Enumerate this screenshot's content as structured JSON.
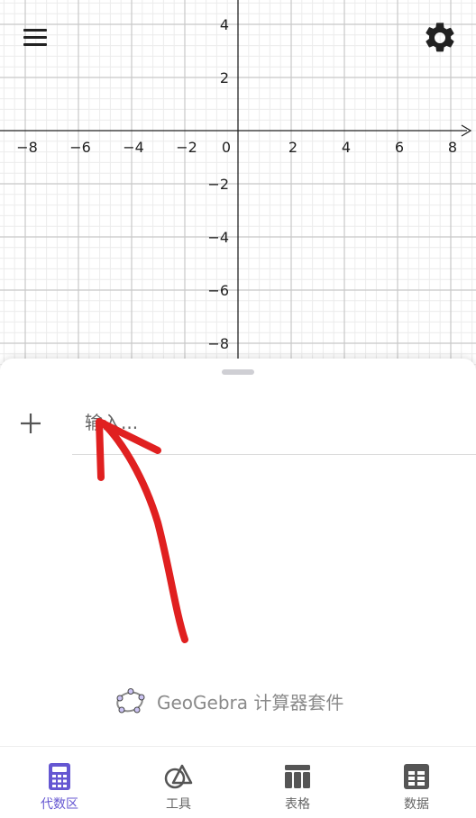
{
  "graph": {
    "x_range": [
      -9,
      9
    ],
    "y_range": [
      -9,
      5
    ],
    "x_ticks": [
      -8,
      -6,
      -4,
      -2,
      2,
      4,
      6,
      8
    ],
    "y_ticks": [
      4,
      2,
      -2,
      -4,
      -6,
      -8
    ],
    "origin_label": "0",
    "x_tick_labels": [
      "−8",
      "−6",
      "−4",
      "−2",
      "2",
      "4",
      "6",
      "8"
    ],
    "y_tick_labels": [
      "4",
      "2",
      "−2",
      "−4",
      "−6",
      "−8"
    ]
  },
  "header": {
    "menu_icon": "hamburger-menu-icon",
    "settings_icon": "gear-icon"
  },
  "algebra": {
    "add_icon": "plus-icon",
    "input_placeholder": "输入..."
  },
  "brand": {
    "name": "GeoGebra 计算器套件",
    "logo_icon": "geogebra-logo-icon"
  },
  "nav": {
    "items": [
      {
        "label": "代数区",
        "icon": "calculator-icon",
        "active": true
      },
      {
        "label": "工具",
        "icon": "shapes-icon",
        "active": false
      },
      {
        "label": "表格",
        "icon": "table-icon",
        "active": false
      },
      {
        "label": "数据",
        "icon": "spreadsheet-icon",
        "active": false
      }
    ]
  },
  "colors": {
    "accent": "#6557d2",
    "annotation": "#e02020",
    "grid_major": "#c8c8c8",
    "grid_minor": "#ececec"
  }
}
